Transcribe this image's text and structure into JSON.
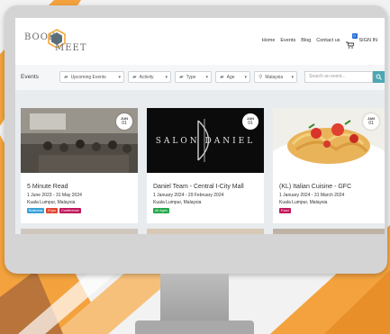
{
  "brand": {
    "word1": "BOOK",
    "word2": "MEET",
    "hex_text": "to"
  },
  "nav": {
    "links": [
      "Home",
      "Events",
      "Blog",
      "Contact us"
    ],
    "cart_count": "0",
    "signin": "SIGN IN"
  },
  "filters": {
    "label": "Events",
    "dropdowns": [
      "Upcoming Events",
      "Activity",
      "Type",
      "Age",
      "Malaysia"
    ],
    "search_placeholder": "Search an event..."
  },
  "events": [
    {
      "month": "JUN",
      "day": "01",
      "title": "5 Minute Read",
      "dates": "1 June 2023 - 31 May 2024",
      "location": "Kuala Lumpur, Malaysia",
      "tags": [
        {
          "label": "Business",
          "color": "#3aa0d8"
        },
        {
          "label": "Expo",
          "color": "#e2452e"
        },
        {
          "label": "Conference",
          "color": "#c2185b"
        }
      ]
    },
    {
      "month": "JAN",
      "day": "01",
      "title": "Daniel Team - Central I-City Mall",
      "dates": "1 January 2024 - 29 February 2024",
      "location": "Kuala Lumpur, Malaysia",
      "image_text": "SALON DANIEL",
      "tags": [
        {
          "label": "All Ages",
          "color": "#22a84a"
        }
      ]
    },
    {
      "month": "JAN",
      "day": "01",
      "title": "(KL) Italian Cuisine - GFC",
      "dates": "1 January 2024 - 31 March 2024",
      "location": "Kuala Lumpur, Malaysia",
      "tags": [
        {
          "label": "Food",
          "color": "#c2185b"
        }
      ]
    }
  ],
  "colors": {
    "accent": "#4aa7b3",
    "brand_hex": "#f2a93b",
    "background_orange": "#f4a23d"
  }
}
